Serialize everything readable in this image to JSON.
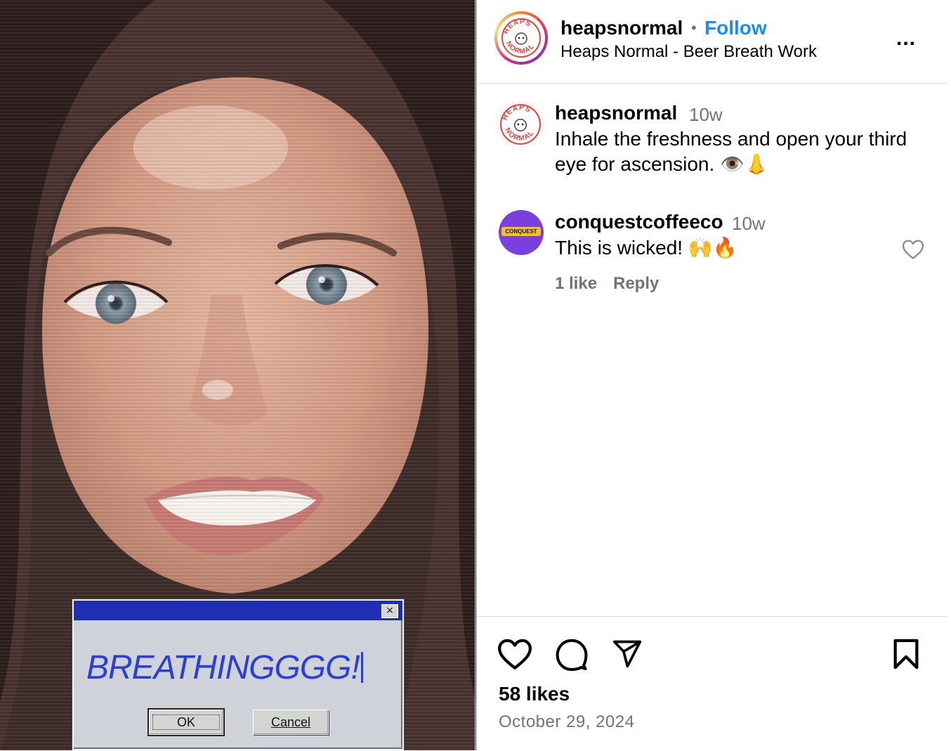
{
  "media": {
    "dialog": {
      "message": "BREATHINGGGG!",
      "close_glyph": "×",
      "ok_label": "OK",
      "cancel_label": "Cancel"
    }
  },
  "header": {
    "username": "heapsnormal",
    "separator": "•",
    "follow_label": "Follow",
    "subtitle": "Heaps Normal - Beer Breath Work",
    "more_label": "..."
  },
  "logo": {
    "top_text": "HEAPS",
    "bottom_text": "NORMAL"
  },
  "caption": {
    "username": "heapsnormal",
    "time": "10w",
    "text": "Inhale the freshness and open your third eye for ascension. 👁️👃"
  },
  "comment": {
    "username": "conquestcoffeeco",
    "time": "10w",
    "text": "This is wicked! 🙌🔥",
    "likes": "1 like",
    "reply_label": "Reply",
    "avatar_text": "CONQUEST"
  },
  "footer": {
    "likes": "58 likes",
    "date": "October 29, 2024"
  },
  "colors": {
    "follow": "#1a8cf5",
    "muted": "#737373",
    "dialog_title": "#1f2fb5",
    "dialog_text": "#2a3fd6"
  },
  "icons": {
    "like": "heart-icon",
    "comment": "comment-bubble-icon",
    "share": "paper-plane-icon",
    "save": "bookmark-icon",
    "more": "more-dots-icon"
  }
}
